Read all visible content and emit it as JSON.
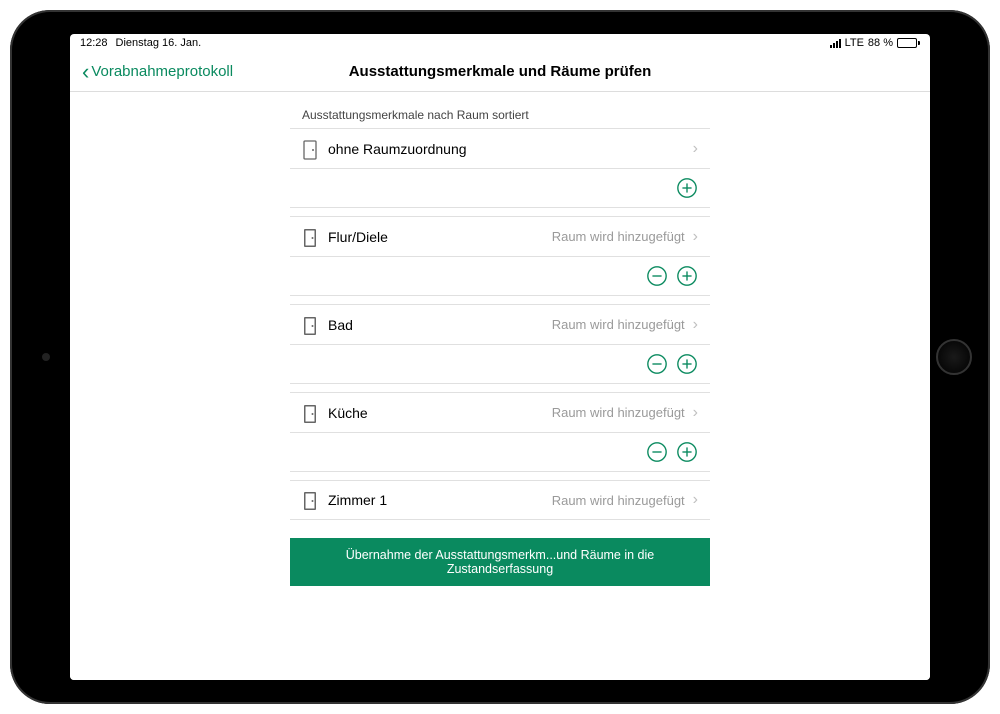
{
  "statusBar": {
    "time": "12:28",
    "date": "Dienstag 16. Jan.",
    "network": "LTE",
    "batteryPercent": "88 %"
  },
  "nav": {
    "back": "Vorabnahmeprotokoll",
    "title": "Ausstattungsmerkmale und Räume prüfen"
  },
  "sectionHeader": "Ausstattungsmerkmale nach Raum sortiert",
  "rooms": [
    {
      "name": "ohne Raumzuordnung",
      "status": "",
      "hasMinus": false,
      "hasPlus": true
    },
    {
      "name": "Flur/Diele",
      "status": "Raum wird hinzugefügt",
      "hasMinus": true,
      "hasPlus": true
    },
    {
      "name": "Bad",
      "status": "Raum wird hinzugefügt",
      "hasMinus": true,
      "hasPlus": true
    },
    {
      "name": "Küche",
      "status": "Raum wird hinzugefügt",
      "hasMinus": true,
      "hasPlus": true
    },
    {
      "name": "Zimmer 1",
      "status": "Raum wird hinzugefügt",
      "hasMinus": false,
      "hasPlus": false
    }
  ],
  "primaryButton": "Übernahme der Ausstattungsmerkm...und Räume in die Zustandserfassung",
  "colors": {
    "accent": "#0a8a5f"
  }
}
